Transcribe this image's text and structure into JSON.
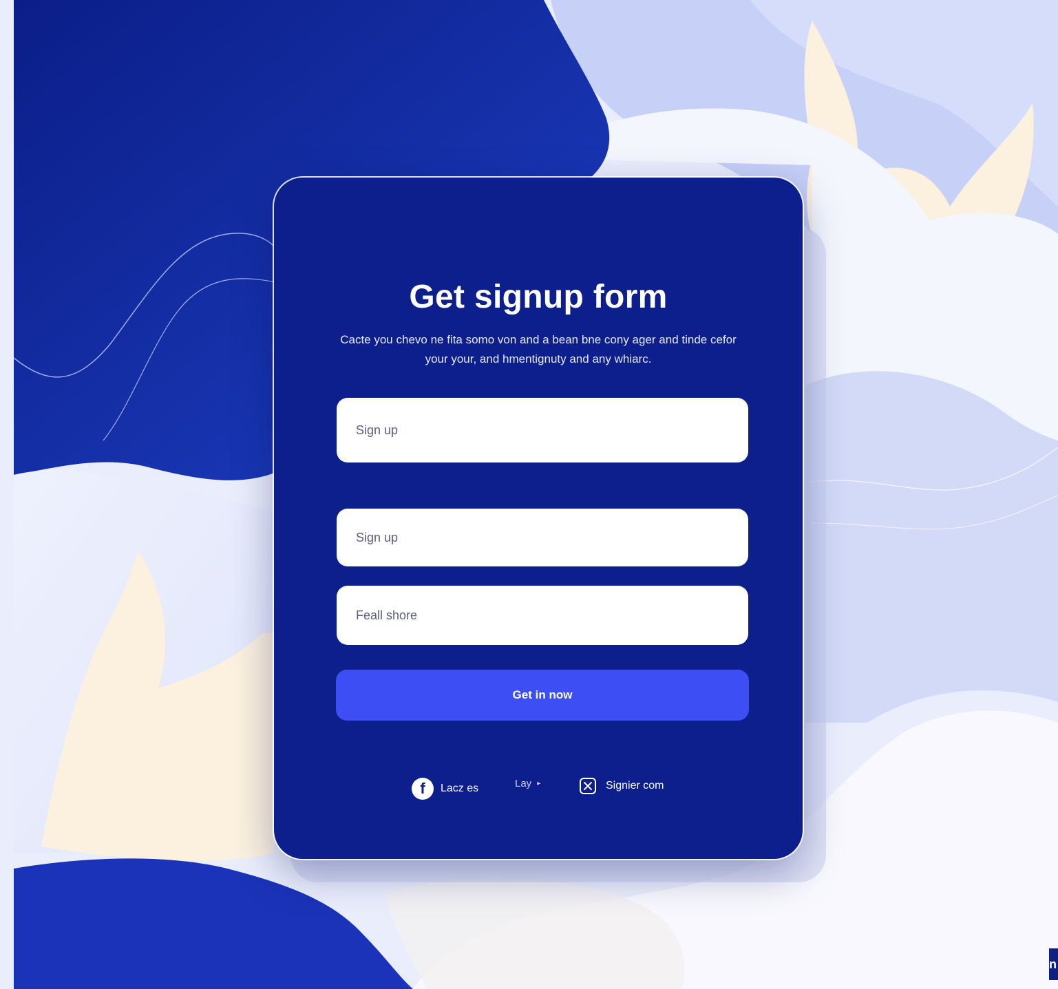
{
  "form": {
    "title": "Get signup form",
    "subtitle": "Cacte you chevo ne fita somo von and a bean bne cony ager and tinde cefor your your, and hmentignuty and any whiarc.",
    "fields": [
      {
        "placeholder": "Sign up"
      },
      {
        "placeholder": "Sign up"
      },
      {
        "placeholder": "Feall shore"
      }
    ],
    "submit_label": "Get in now"
  },
  "social": {
    "facebook_label": "Lacz es",
    "middle_label": "Lay",
    "x_label": "Signier com"
  },
  "colors": {
    "card": "#0c1f8c",
    "button": "#3d4ef5",
    "background_dark": "#1a35b8",
    "background_light": "#e8edfc",
    "background_cream": "#fbf1de"
  },
  "corner_badge": {
    "text": "n"
  }
}
